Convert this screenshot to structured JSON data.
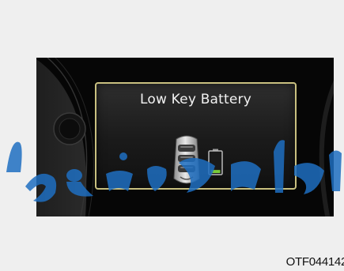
{
  "display": {
    "message": "Low Key Battery",
    "key_icon": "smart-key-fob-icon",
    "battery_icon": "low-battery-icon",
    "battery_level": 0.15
  },
  "figure": {
    "code": "OTF044142"
  },
  "colors": {
    "frame_border": "#c9c080",
    "screen_background": "#060606",
    "battery_fill": "#7acb3a",
    "watermark": "#1e6fc1"
  }
}
